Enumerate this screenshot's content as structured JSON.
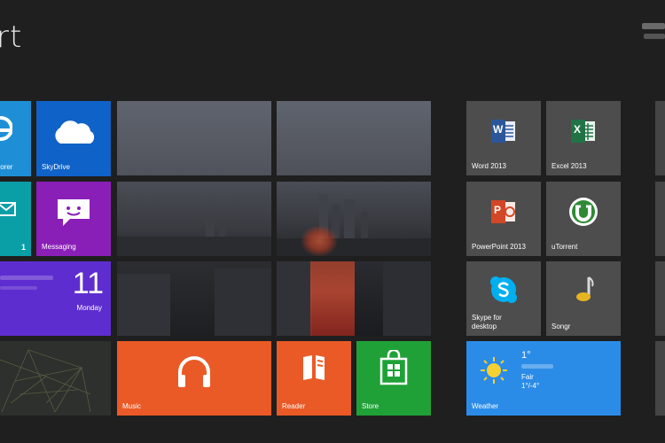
{
  "screen": {
    "title": "rt"
  },
  "tiles": {
    "explorer": {
      "label": "plorer"
    },
    "skydrive": {
      "label": "SkyDrive"
    },
    "mail": {
      "badge": "1"
    },
    "messaging": {
      "label": "Messaging"
    },
    "calendar": {
      "day": "11",
      "weekday": "Monday"
    },
    "music": {
      "label": "Music"
    },
    "reader": {
      "label": "Reader"
    },
    "store": {
      "label": "Store"
    },
    "word": {
      "label": "Word 2013",
      "glyph": "W"
    },
    "excel": {
      "label": "Excel 2013",
      "glyph": "X"
    },
    "powerpoint": {
      "label": "PowerPoint 2013",
      "glyph": "P"
    },
    "utorrent": {
      "label": "uTorrent"
    },
    "skype": {
      "label_line1": "Skype for",
      "label_line2": "desktop"
    },
    "songr": {
      "label": "Songr"
    },
    "weather": {
      "label": "Weather",
      "temp": "1°",
      "condition": "Fair",
      "range": "1°/-4°"
    }
  },
  "colors": {
    "background": "#1f1f1f",
    "ie_blue": "#1e8fd6",
    "skydrive_blue": "#0f62c7",
    "mail_teal": "#0a9ea7",
    "messaging_purple": "#8a1fb8",
    "calendar_purple": "#5e2dd0",
    "music_orange": "#ea5a26",
    "reader_orange": "#ea5a26",
    "store_green": "#1fa137",
    "weather_blue": "#2b8ce8",
    "desktop_tile_gray": "#4d4d4d"
  }
}
